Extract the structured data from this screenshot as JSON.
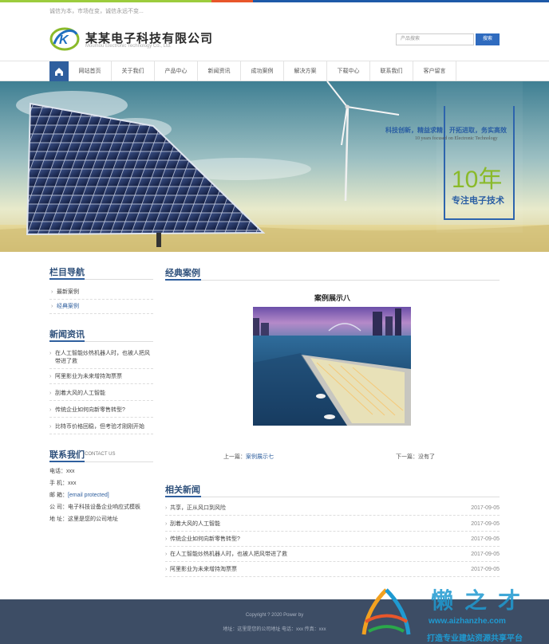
{
  "top": {
    "slogan": "诚信为本，市场在变，诚信永远不变..."
  },
  "header": {
    "company_cn": "某某电子科技有限公司",
    "company_en": "Moumou Electronic Technology Co., Ltd.",
    "search_placeholder": "产品搜索",
    "search_button": "搜索"
  },
  "nav": {
    "items": [
      "网站首页",
      "关于我们",
      "产品中心",
      "新闻资讯",
      "成功案例",
      "解决方案",
      "下载中心",
      "联系我们",
      "客户留言"
    ]
  },
  "banner": {
    "line1": "科技创新，精益求精，开拓进取，务实高效",
    "line2": "10 years focused on Electronic Technology",
    "big": "10年",
    "big2": "专注电子技术"
  },
  "sidebar": {
    "nav_title": "栏目导航",
    "nav_items": [
      "最新案例",
      "经典案例"
    ],
    "news_title": "新闻资讯",
    "news_items": [
      "在人工智能炒热机器人时，也被人把风带进了救",
      "阿里影业为未来增持淘票票",
      "刮着大风的人工智能",
      "传统企业如何向新零售转型?",
      "比特币价格回稳，但考验才刚刚开始"
    ],
    "contact_title": "联系我们",
    "contact_sub": "CONTACT US",
    "contact": {
      "phone": "电话：xxx",
      "mobile": "手 机：xxx",
      "email_label": "邮 箱：",
      "email": "[email protected]",
      "company": "公 司：电子科技设备企业响应式模板",
      "address": "地 址：这里是您的公司地址"
    }
  },
  "main": {
    "section_title": "经典案例",
    "case_title": "案例展示八",
    "prev_label": "上一篇：",
    "prev_link": "案例展示七",
    "next_label": "下一篇：没有了",
    "related_title": "相关新闻",
    "related": [
      {
        "title": "共享，正从风口到风险",
        "date": "2017-09-05"
      },
      {
        "title": "刮着大风的人工智能",
        "date": "2017-09-05"
      },
      {
        "title": "传统企业如何向新零售转型?",
        "date": "2017-09-05"
      },
      {
        "title": "在人工智能炒热机器人时，也被人把风带进了救",
        "date": "2017-09-05"
      },
      {
        "title": "阿里影业为未来增持淘票票",
        "date": "2017-09-05"
      }
    ]
  },
  "footer": {
    "copyright": "Copyright ? 2020 Power by",
    "address": "地址：这里是您的公司地址 电话：xxx 传真：xxx"
  },
  "watermark": {
    "brand": "懒之才",
    "url": "www.aizhanzhe.com",
    "slogan": "打造专业建站资源共享平台"
  },
  "colors": {
    "accent": "#2f5f9e",
    "green": "#8aba2a",
    "footer": "#3d4d65"
  }
}
